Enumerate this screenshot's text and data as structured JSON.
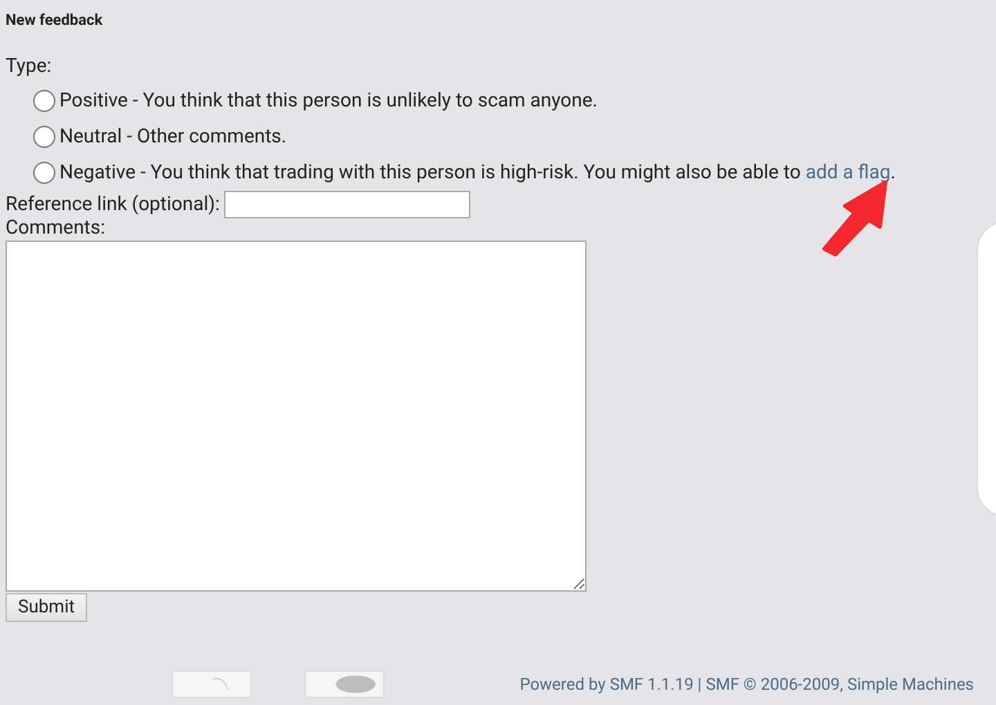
{
  "heading": "New feedback",
  "type_label": "Type:",
  "options": [
    {
      "text": "Positive - You think that this person is unlikely to scam anyone.",
      "selected": false
    },
    {
      "text": "Neutral - Other comments.",
      "selected": false
    },
    {
      "text": "Negative - You think that trading with this person is high-risk. You might also be able to ",
      "link": "add a flag",
      "after": ".",
      "selected": false
    }
  ],
  "reference_label": "Reference link (optional):",
  "comments_label": "Comments:",
  "submit": "Submit",
  "footer": {
    "powered": "Powered by SMF 1.1.19",
    "separator": " | ",
    "copyright": "SMF © 2006-2009, Simple Machines"
  }
}
